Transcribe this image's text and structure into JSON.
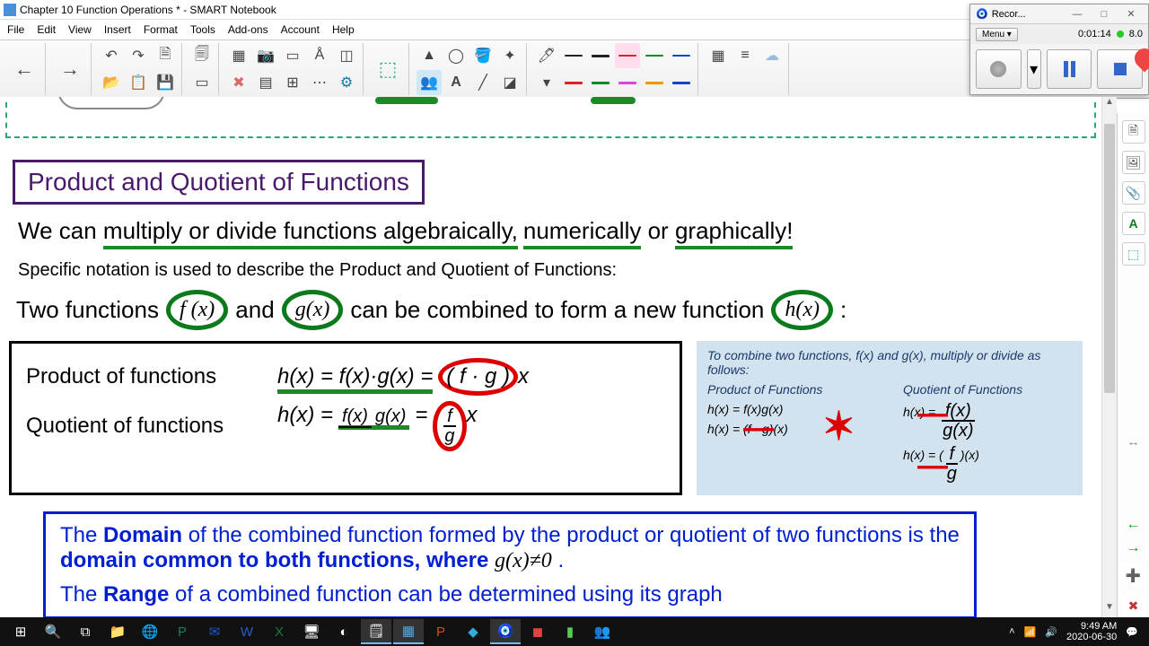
{
  "window": {
    "title": "Chapter 10 Function Operations * - SMART Notebook"
  },
  "menu": {
    "file": "File",
    "edit": "Edit",
    "view": "View",
    "insert": "Insert",
    "format": "Format",
    "tools": "Tools",
    "addons": "Add-ons",
    "account": "Account",
    "help": "Help"
  },
  "recorder": {
    "title": "Recor...",
    "menu": "Menu ▾",
    "time": "0:01:14",
    "size": "8.0"
  },
  "content": {
    "section_title": "Product and Quotient of Functions",
    "intro_a": "We can ",
    "intro_b": "multiply or divide functions algebraically,",
    "intro_c": " numerically",
    "intro_d": " or ",
    "intro_e": "graphically!",
    "specific": "Specific notation is used to describe the Product and Quotient of Functions:",
    "twofn_a": "Two functions",
    "twofn_fx": "f (x)",
    "twofn_and": "and",
    "twofn_gx": "g(x)",
    "twofn_b": "can be combined to form a new function",
    "twofn_hx": "h(x)",
    "twofn_colon": ":",
    "product_label": "Product of functions",
    "product_eq_a": "h(x) = f(x)·g(x) =",
    "product_eq_b": "( f · g )",
    "product_eq_c": "x",
    "quotient_label": "Quotient of functions",
    "quotient_eq_a": "h(x) =",
    "quot_frac_n": "f(x)",
    "quot_frac_d": "g(x)",
    "quotient_eq_b": "=",
    "quot_frac2_n": "f",
    "quot_frac2_d": "g",
    "quotient_eq_c": "x",
    "combine_hdr": "To combine two functions, f(x) and g(x), multiply or divide as follows:",
    "combine_prod_t": "Product of Functions",
    "combine_prod_1": "h(x) = f(x)g(x)",
    "combine_prod_2": "h(x) = (f · g)(x)",
    "combine_quot_t": "Quotient of Functions",
    "combine_quot_1a": "h(x) =",
    "combine_quot_1n": "f(x)",
    "combine_quot_1d": "g(x)",
    "combine_quot_2a": "h(x) =",
    "combine_quot_2n": "f",
    "combine_quot_2d": "g",
    "combine_quot_2b": "(x)",
    "domain_a": "The ",
    "domain_b": "Domain",
    "domain_c": " of the combined function formed by the product or quotient of two functions is the ",
    "domain_d": "domain common to both functions, where ",
    "domain_e": "g(x)≠0",
    "domain_f": " .",
    "range_a": "The ",
    "range_b": "Range",
    "range_c": " of a combined function can be determined using its graph"
  },
  "tray": {
    "time": "9:49 AM",
    "date": "2020-06-30"
  },
  "colors": {
    "pen1": "#222",
    "pen2": "#222",
    "pen3": "#d22",
    "pen4": "#0a8a2a",
    "pen5": "#14c",
    "pen6": "#d22",
    "pen7": "#0a8a2a",
    "pen8": "#d4d",
    "pen9": "#e90",
    "pen10": "#14c"
  }
}
